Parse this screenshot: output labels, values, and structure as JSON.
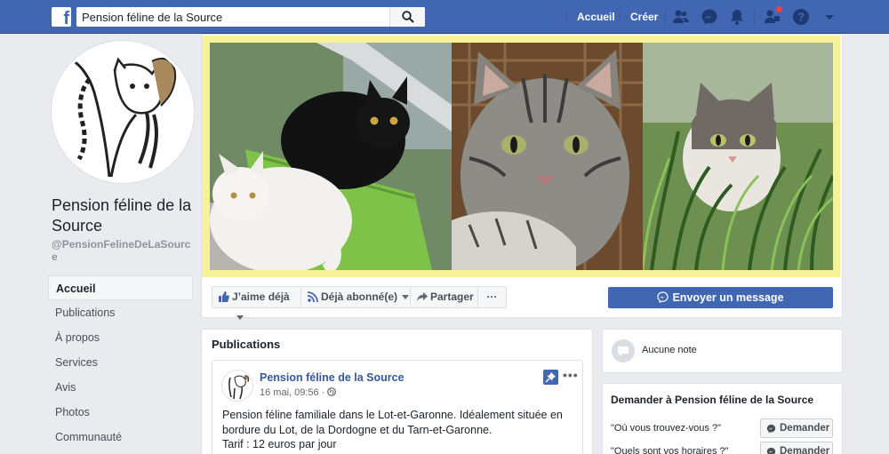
{
  "topbar": {
    "logo_letter": "f",
    "search_value": "Pension féline de la Source",
    "nav_home": "Accueil",
    "nav_create": "Créer"
  },
  "page": {
    "title": "Pension féline de la Source",
    "handle": "@PensionFelineDeLaSource"
  },
  "sidebar": {
    "items": [
      {
        "label": "Accueil"
      },
      {
        "label": "Publications"
      },
      {
        "label": "À propos"
      },
      {
        "label": "Services"
      },
      {
        "label": "Avis"
      },
      {
        "label": "Photos"
      },
      {
        "label": "Communauté"
      }
    ]
  },
  "actions": {
    "like": "J’aime déjà",
    "follow": "Déjà abonné(e)",
    "share": "Partager",
    "more": "···",
    "message": "Envoyer un message"
  },
  "publications": {
    "title": "Publications",
    "post": {
      "author": "Pension féline de la Source",
      "date": "16 mai, 09:56 · ",
      "text_line1": "Pension féline familiale dans le Lot-et-Garonne. Idéalement située en",
      "text_line2": "bordure du Lot, de la Dordogne et du Tarn-et-Garonne.",
      "text_line3": "Tarif : 12 euros par jour",
      "more": "•••"
    }
  },
  "notes": {
    "label": "Aucune note"
  },
  "ask": {
    "title": "Demander à Pension féline de la Source",
    "questions": [
      {
        "text": "\"Où vous trouvez-vous ?\"",
        "button": "Demander"
      },
      {
        "text": "\"Quels sont vos horaires ?\"",
        "button": "Demander"
      }
    ]
  },
  "colors": {
    "brand": "#4267b2",
    "cover_frame": "#f6f29a",
    "link": "#365899"
  }
}
